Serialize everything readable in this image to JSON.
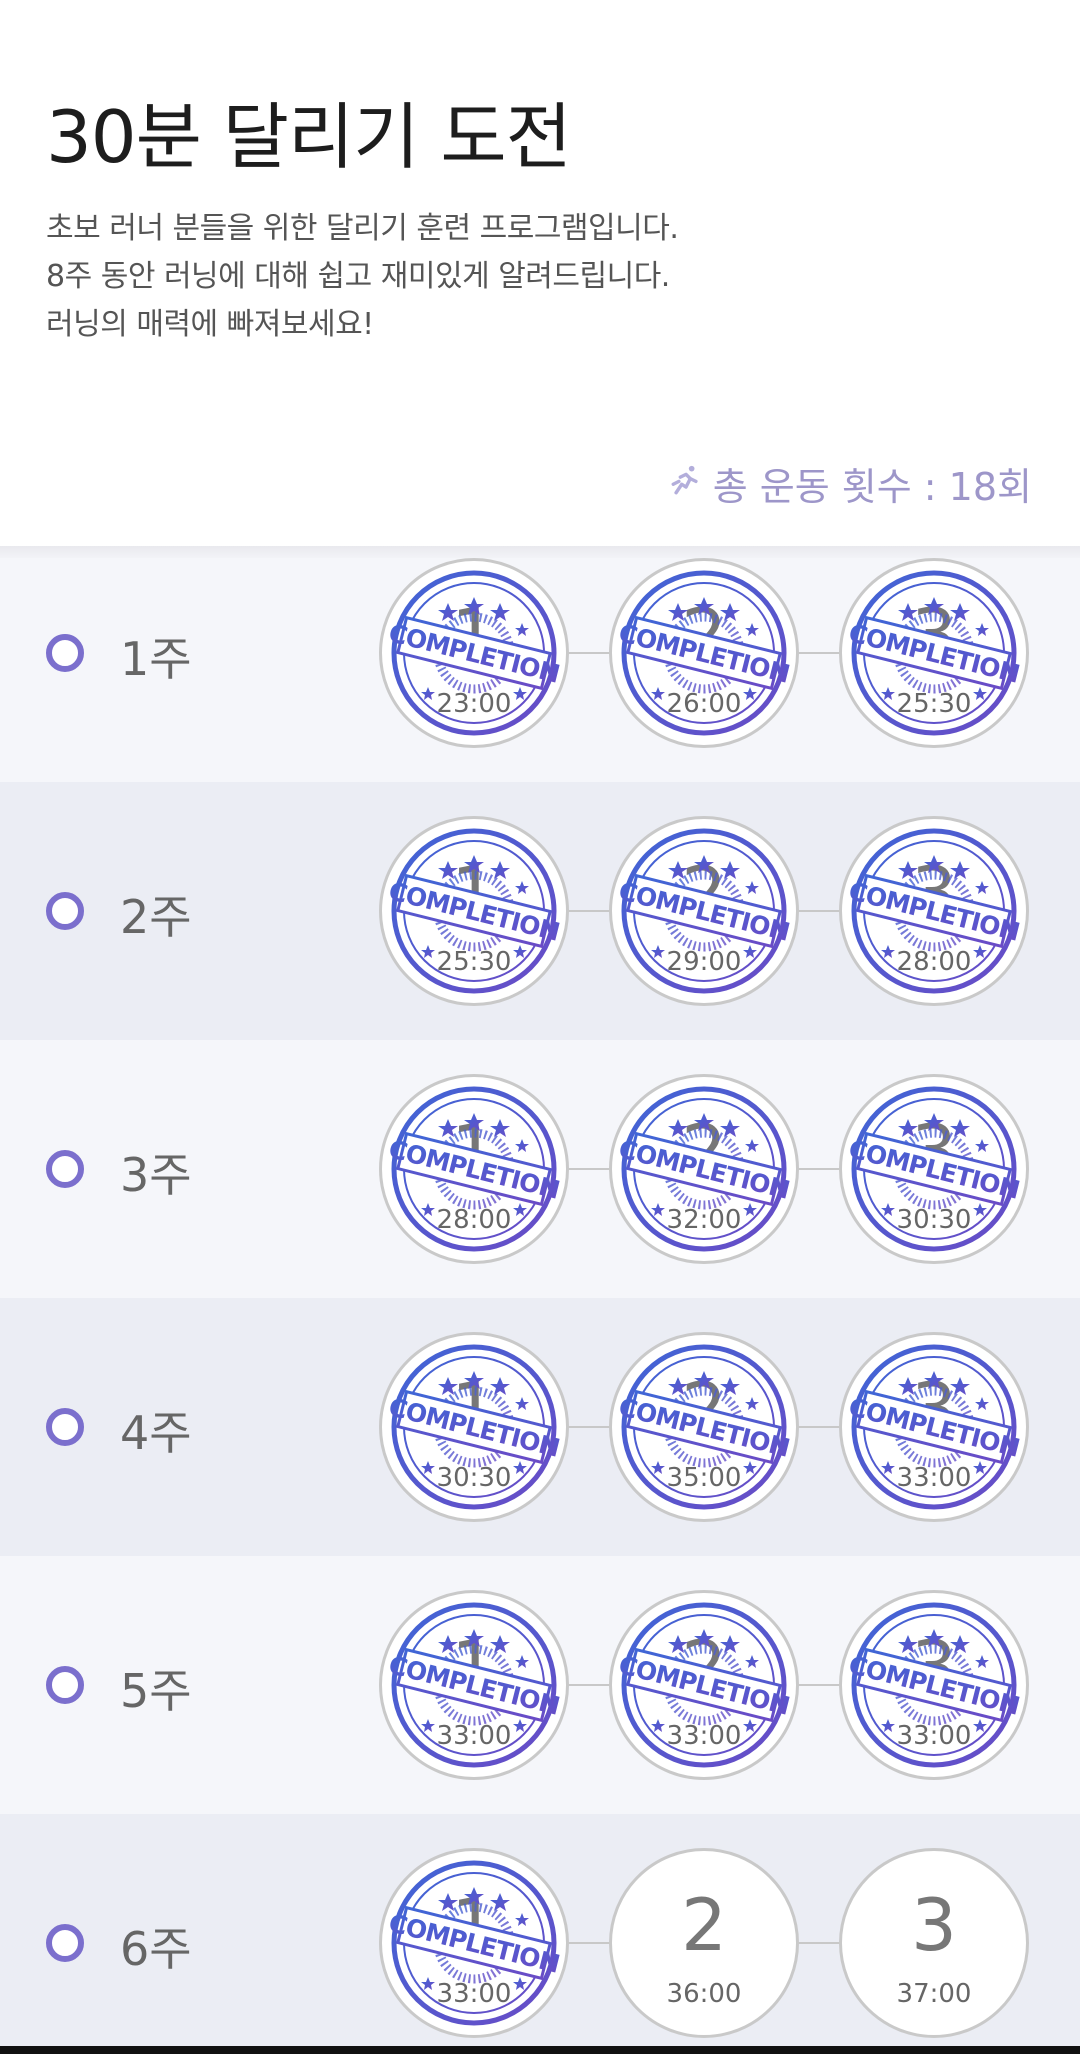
{
  "header": {
    "title": "30분 달리기 도전",
    "description": [
      "초보 러너 분들을 위한 달리기 훈련 프로그램입니다.",
      "8주 동안 러닝에 대해 쉽고 재미있게 알려드립니다.",
      "러닝의 매력에 빠져보세요!"
    ],
    "total_label": "총 운동 횟수 : 18회",
    "total_icon": "runner-icon"
  },
  "stamp_text": "COMPLETION",
  "colors": {
    "accent": "#7b6fcd",
    "stamp_blue": "#3f66d6",
    "stamp_purple": "#6a4bc6"
  },
  "weeks": [
    {
      "label": "1주",
      "days": [
        {
          "num": "1",
          "time": "23:00",
          "completed": true
        },
        {
          "num": "2",
          "time": "26:00",
          "completed": true
        },
        {
          "num": "3",
          "time": "25:30",
          "completed": true
        }
      ]
    },
    {
      "label": "2주",
      "days": [
        {
          "num": "1",
          "time": "25:30",
          "completed": true
        },
        {
          "num": "2",
          "time": "29:00",
          "completed": true
        },
        {
          "num": "3",
          "time": "28:00",
          "completed": true
        }
      ]
    },
    {
      "label": "3주",
      "days": [
        {
          "num": "1",
          "time": "28:00",
          "completed": true
        },
        {
          "num": "2",
          "time": "32:00",
          "completed": true
        },
        {
          "num": "3",
          "time": "30:30",
          "completed": true
        }
      ]
    },
    {
      "label": "4주",
      "days": [
        {
          "num": "1",
          "time": "30:30",
          "completed": true
        },
        {
          "num": "2",
          "time": "35:00",
          "completed": true
        },
        {
          "num": "3",
          "time": "33:00",
          "completed": true
        }
      ]
    },
    {
      "label": "5주",
      "days": [
        {
          "num": "1",
          "time": "33:00",
          "completed": true
        },
        {
          "num": "2",
          "time": "33:00",
          "completed": true
        },
        {
          "num": "3",
          "time": "33:00",
          "completed": true
        }
      ]
    },
    {
      "label": "6주",
      "days": [
        {
          "num": "1",
          "time": "33:00",
          "completed": true
        },
        {
          "num": "2",
          "time": "36:00",
          "completed": false
        },
        {
          "num": "3",
          "time": "37:00",
          "completed": false
        }
      ]
    }
  ]
}
